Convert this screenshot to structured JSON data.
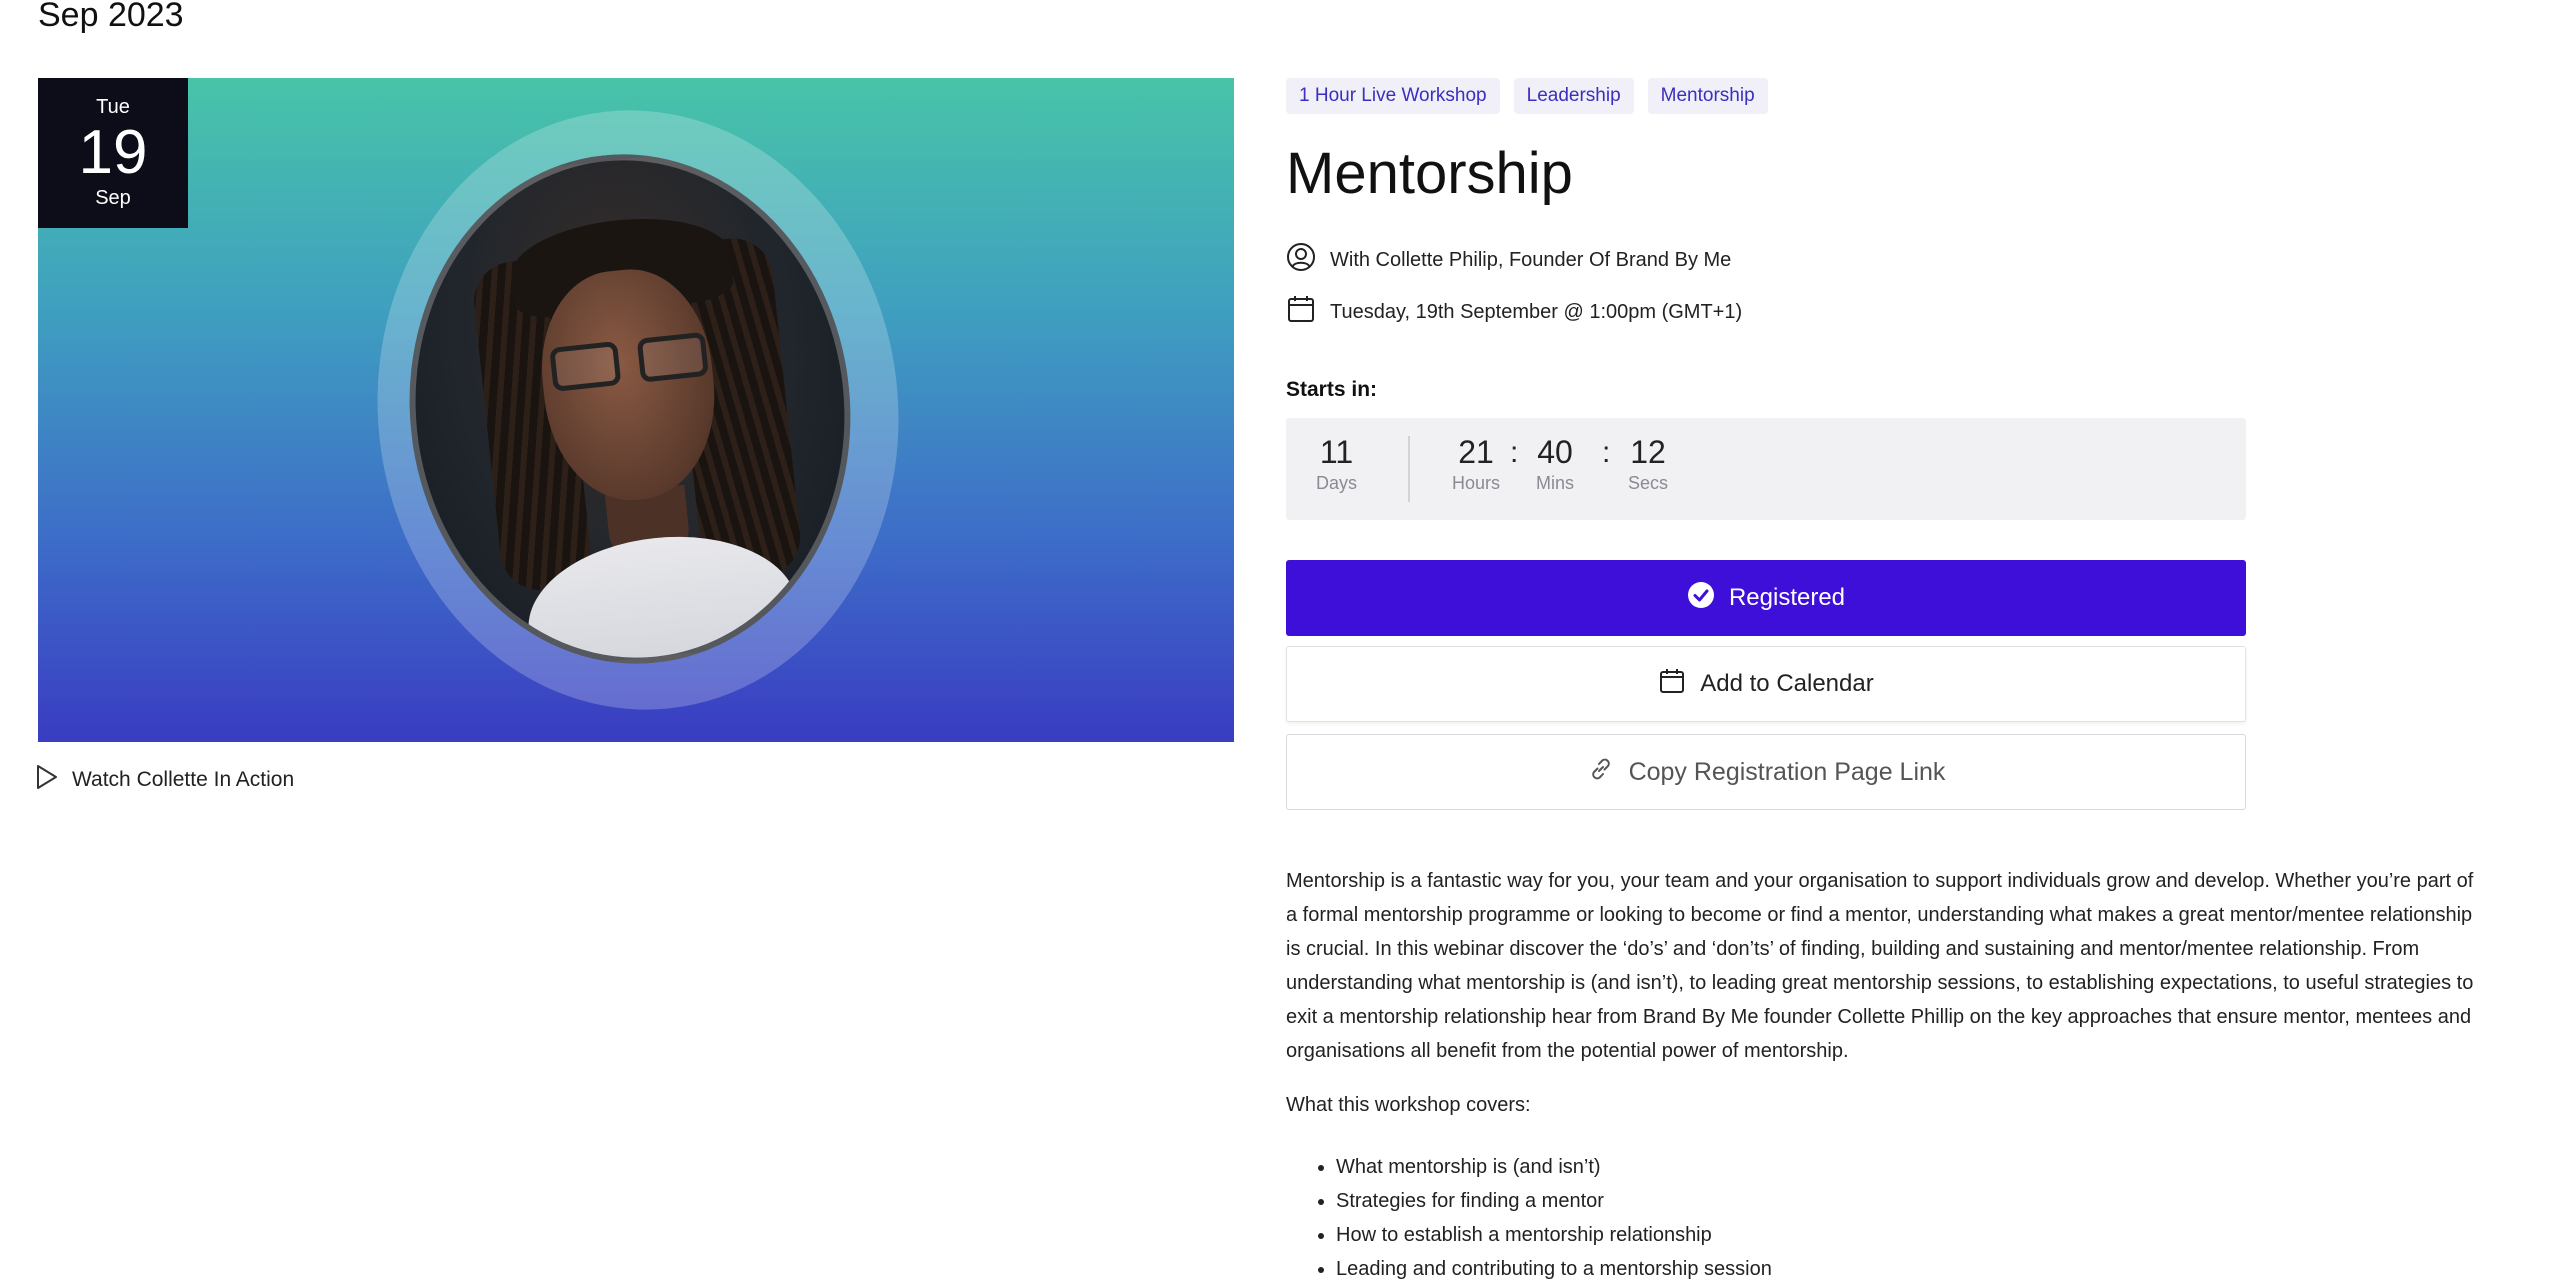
{
  "month_heading": "Sep 2023",
  "hero": {
    "badge_dow": "Tue",
    "badge_day": "19",
    "badge_month": "Sep",
    "gradient_top": "#48c4a8",
    "gradient_bottom": "#3a3cc2"
  },
  "watch_link": {
    "label": "Watch Collette In Action",
    "icon": "play-icon"
  },
  "tags": [
    "1 Hour Live Workshop",
    "Leadership",
    "Mentorship"
  ],
  "event": {
    "title": "Mentorship",
    "host": "With Collette Philip, Founder Of Brand By Me",
    "datetime": "Tuesday, 19th September @ 1:00pm (GMT+1)"
  },
  "countdown": {
    "starts_label": "Starts in:",
    "days": {
      "value": "11",
      "label": "Days"
    },
    "hours": {
      "value": "21",
      "label": "Hours"
    },
    "mins": {
      "value": "40",
      "label": "Mins"
    },
    "secs": {
      "value": "12",
      "label": "Secs"
    },
    "separator": ":"
  },
  "buttons": {
    "registered": "Registered",
    "add_calendar": "Add to Calendar",
    "copy_link": "Copy Registration Page Link"
  },
  "colors": {
    "accent": "#3d0fd9",
    "tag_bg": "#f1f0f8",
    "tag_text": "#3a2fbf"
  },
  "description": "Mentorship is a fantastic way for you, your team and your organisation to support individuals grow and develop. Whether you’re part of a formal mentorship programme or looking to become or find a mentor, understanding what makes a great mentor/mentee relationship is crucial. In this webinar discover the ‘do’s’ and ‘don’ts’ of finding, building and sustaining and mentor/mentee relationship. From understanding what mentorship is (and isn’t), to leading great mentorship sessions, to establishing expectations, to useful strategies to exit a mentorship relationship hear from Brand By Me founder Collette Phillip on the key approaches that ensure mentor, mentees and organisations all benefit from the potential power of mentorship.",
  "covers": {
    "label": "What this workshop covers:",
    "items": [
      "What mentorship is (and isn’t)",
      "Strategies for finding a mentor",
      "How to establish a mentorship relationship",
      "Leading and contributing to a mentorship session"
    ]
  }
}
